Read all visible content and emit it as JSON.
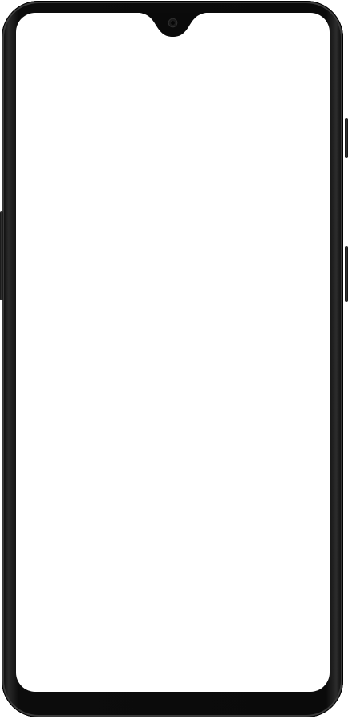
{
  "device": {
    "name": "",
    "frame_color": "#0a0a0a",
    "screen_color": "#ffffff",
    "notch_type": "waterdrop",
    "camera_icon": "front-camera-icon"
  },
  "screen": {
    "content": ""
  }
}
